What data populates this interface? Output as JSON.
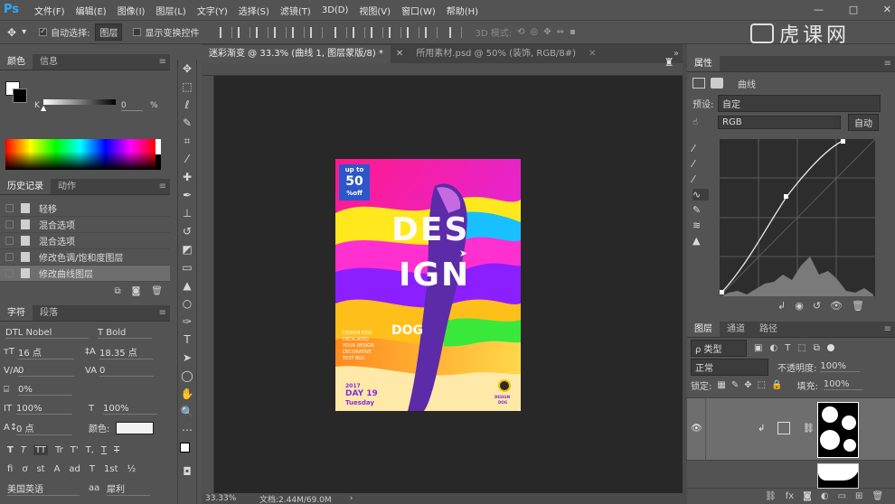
{
  "app": {
    "logo": "Ps"
  },
  "menu": [
    "文件(F)",
    "编辑(E)",
    "图像(I)",
    "图层(L)",
    "文字(Y)",
    "选择(S)",
    "滤镜(T)",
    "3D(D)",
    "视图(V)",
    "窗口(W)",
    "帮助(H)"
  ],
  "options": {
    "auto_select_label": "自动选择:",
    "auto_select_value": "图层",
    "show_transform_label": "显示变换控件",
    "mode_3d_label": "3D 模式:"
  },
  "watermark": "虎课网",
  "color_panel": {
    "tabs": [
      "颜色",
      "信息"
    ],
    "slider_label": "K",
    "slider_value": "0",
    "slider_unit": "%"
  },
  "history_panel": {
    "tabs": [
      "历史记录",
      "动作"
    ],
    "items": [
      "轻移",
      "混合选项",
      "混合选项",
      "修改色调/饱和度图层",
      "修改曲线图层"
    ]
  },
  "char_panel": {
    "tabs": [
      "字符",
      "段落"
    ],
    "font_family": "DTL Nobel",
    "font_style": "T Bold",
    "font_size": "16 点",
    "leading": "18.35 点",
    "kerning": "0",
    "tracking": "0",
    "scale_pct": "0%",
    "vscale": "100%",
    "hscale": "100%",
    "baseline": "0 点",
    "color_label": "颜色:",
    "language": "美国英语",
    "aa_label": "aa",
    "aa_value": "犀利",
    "style_buttons": [
      "T",
      "T",
      "TT",
      "Tr",
      "T'",
      "T,",
      "T",
      "T"
    ]
  },
  "doc_tabs": [
    {
      "label": "迷彩渐变 @ 33.3% (曲线 1, 图层蒙版/8) *",
      "active": true
    },
    {
      "label": "所用素材.psd @ 50% (装饰, RGB/8#)",
      "active": false
    }
  ],
  "status": {
    "zoom": "33.33%",
    "doc": "文档:2.44M/69.0M"
  },
  "poster": {
    "badge_top": "up to",
    "badge_num": "50",
    "badge_bottom": "%off",
    "word1": "DES",
    "word2": "IGN",
    "dog": "DOG",
    "side_text": "DESIGN DOG DEDICATED YOUR DESIGN DECORATIVE TEXT BOX",
    "year": "2017",
    "day": "DAY 19",
    "weekday": "Tuesday",
    "corner_top": "DESIGN",
    "corner_bottom": "DOG"
  },
  "properties": {
    "title": "属性",
    "panel_name": "曲线",
    "preset_label": "预设:",
    "preset_value": "自定",
    "channel": "RGB",
    "auto_button": "自动"
  },
  "layers_panel": {
    "tabs": [
      "图层",
      "通道",
      "路径"
    ],
    "kind_label": "ρ 类型",
    "blend_mode": "正常",
    "opacity_label": "不透明度:",
    "opacity_value": "100%",
    "lock_label": "锁定:",
    "fill_label": "填充:",
    "fill_value": "100%"
  },
  "colors": {
    "accent_ps": "#31a8ff",
    "ui_bg": "#535353",
    "canvas_bg": "#282828"
  }
}
